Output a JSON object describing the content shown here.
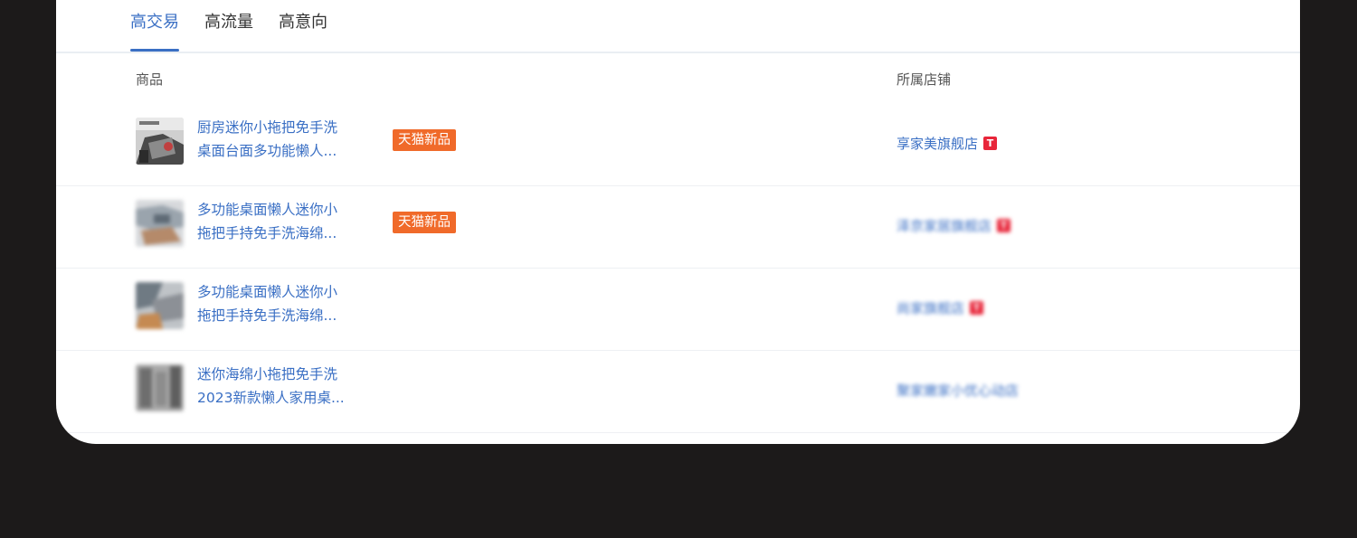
{
  "tabs": [
    {
      "label": "高交易",
      "active": true
    },
    {
      "label": "高流量",
      "active": false
    },
    {
      "label": "高意向",
      "active": false
    }
  ],
  "columns": {
    "product": "商品",
    "shop": "所属店铺"
  },
  "rows": [
    {
      "title_line1": "厨房迷你小拖把免手洗",
      "title_line2": "桌面台面多功能懒人...",
      "tag": "天猫新品",
      "shop": "享家美旗舰店",
      "shop_badge": "T"
    },
    {
      "title_line1": "多功能桌面懒人迷你小",
      "title_line2": "拖把手持免手洗海绵...",
      "tag": "天猫新品",
      "shop": "泽京家居旗舰店",
      "shop_badge": "T"
    },
    {
      "title_line1": "多功能桌面懒人迷你小",
      "title_line2": "拖把手持免手洗海绵...",
      "tag": "",
      "shop": "尚家旗舰店",
      "shop_badge": "T"
    },
    {
      "title_line1": "迷你海绵小拖把免手洗",
      "title_line2": "2023新款懒人家用桌...",
      "tag": "",
      "shop": "聚家嫩家小优心动店",
      "shop_badge": ""
    }
  ],
  "colors": {
    "accent": "#3a6fc4",
    "tag_bg": "#f06a2a",
    "tmall_red": "#e8263a",
    "page_bg": "#1c1a1a"
  }
}
